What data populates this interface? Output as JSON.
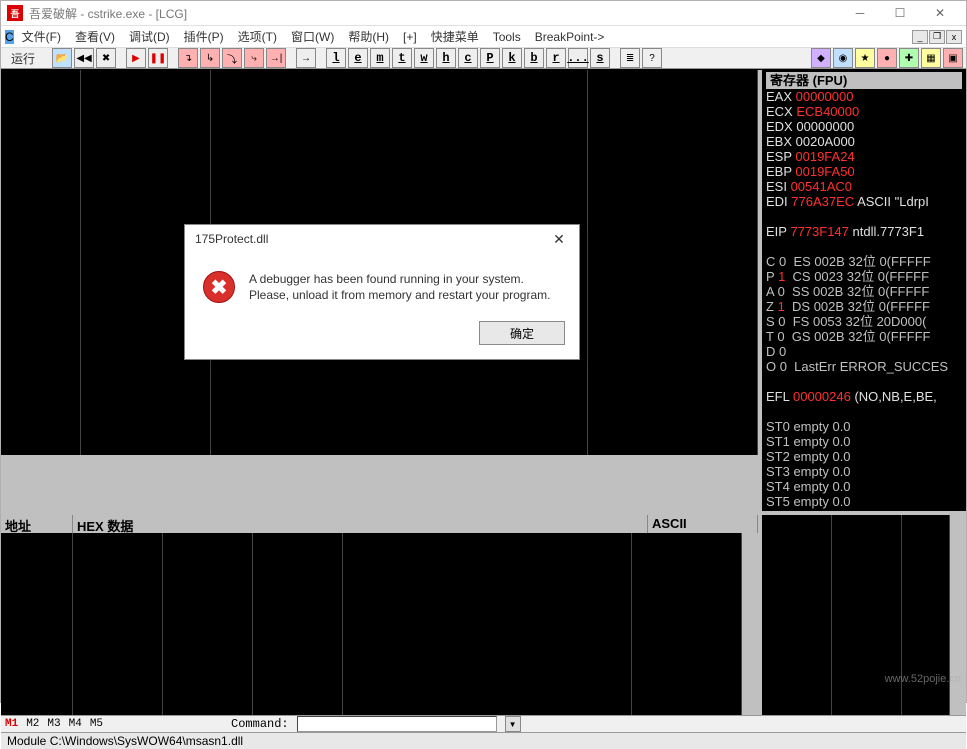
{
  "title": "吾爱破解 - cstrike.exe - [LCG]",
  "menu": [
    "文件(F)",
    "查看(V)",
    "调试(D)",
    "插件(P)",
    "选项(T)",
    "窗口(W)",
    "帮助(H)",
    "[+]",
    "快捷菜单",
    "Tools",
    "BreakPoint->"
  ],
  "toolbar": {
    "run_label": "运行",
    "letters": [
      "l",
      "e",
      "m",
      "t",
      "w",
      "h",
      "c",
      "P",
      "k",
      "b",
      "r",
      "...",
      "s"
    ]
  },
  "registers": {
    "header": "寄存器 (FPU)",
    "lines": [
      {
        "a": "EAX ",
        "b": "00000000",
        "c": ""
      },
      {
        "a": "ECX ",
        "b": "ECB40000",
        "c": ""
      },
      {
        "a": "EDX ",
        "b": "",
        "c": "00000000"
      },
      {
        "a": "EBX ",
        "b": "",
        "c": "0020A000"
      },
      {
        "a": "ESP ",
        "b": "0019FA24",
        "c": ""
      },
      {
        "a": "EBP ",
        "b": "0019FA50",
        "c": ""
      },
      {
        "a": "ESI ",
        "b": "00541AC0",
        "c": ""
      },
      {
        "a": "EDI ",
        "b": "776A37EC",
        "c": " ASCII \"LdrpI"
      }
    ],
    "eip": {
      "a": "EIP ",
      "b": "7773F147",
      "c": " ntdll.7773F1"
    },
    "flags": [
      "C 0  ES 002B 32位 0(FFFFF",
      "P 1  CS 0023 32位 0(FFFFF",
      "A 0  SS 002B 32位 0(FFFFF",
      "Z 1  DS 002B 32位 0(FFFFF",
      "S 0  FS 0053 32位 20D000(",
      "T 0  GS 002B 32位 0(FFFFF",
      "D 0",
      "O 0  LastErr ERROR_SUCCES"
    ],
    "efl": {
      "a": "EFL ",
      "b": "00000246",
      "c": " (NO,NB,E,BE,"
    },
    "fpu": [
      "ST0 empty 0.0",
      "ST1 empty 0.0",
      "ST2 empty 0.0",
      "ST3 empty 0.0",
      "ST4 empty 0.0",
      "ST5 empty 0.0"
    ]
  },
  "dump": {
    "h1": "地址",
    "h2": "HEX 数据",
    "h3": "ASCII"
  },
  "bottom": {
    "marks": [
      "M1",
      "M2",
      "M3",
      "M4",
      "M5"
    ],
    "command_label": "Command:"
  },
  "status": "Module C:\\Windows\\SysWOW64\\msasn1.dll",
  "watermark": "www.52pojie.cn",
  "dialog": {
    "title": "175Protect.dll",
    "line1": "A debugger has been found running in your system.",
    "line2": "Please, unload it from memory and restart your program.",
    "ok": "确定"
  }
}
